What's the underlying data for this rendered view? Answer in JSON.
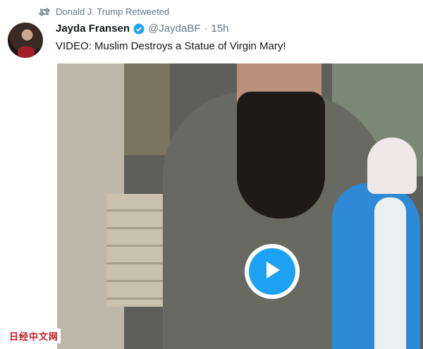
{
  "retweet": {
    "icon": "retweet-icon",
    "label": "Donald J. Trump Retweeted"
  },
  "tweet": {
    "display_name": "Jayda Fransen",
    "verified": true,
    "handle": "@JaydaBF",
    "separator": "·",
    "time": "15h",
    "text": "VIDEO: Muslim Destroys a Statue of Virgin Mary!"
  },
  "media": {
    "type": "video",
    "play_icon": "play-icon"
  },
  "watermark": "日经中文网",
  "colors": {
    "accent": "#1da1f2",
    "secondary_text": "#657786",
    "primary_text": "#14171a",
    "watermark": "#c4121f"
  }
}
